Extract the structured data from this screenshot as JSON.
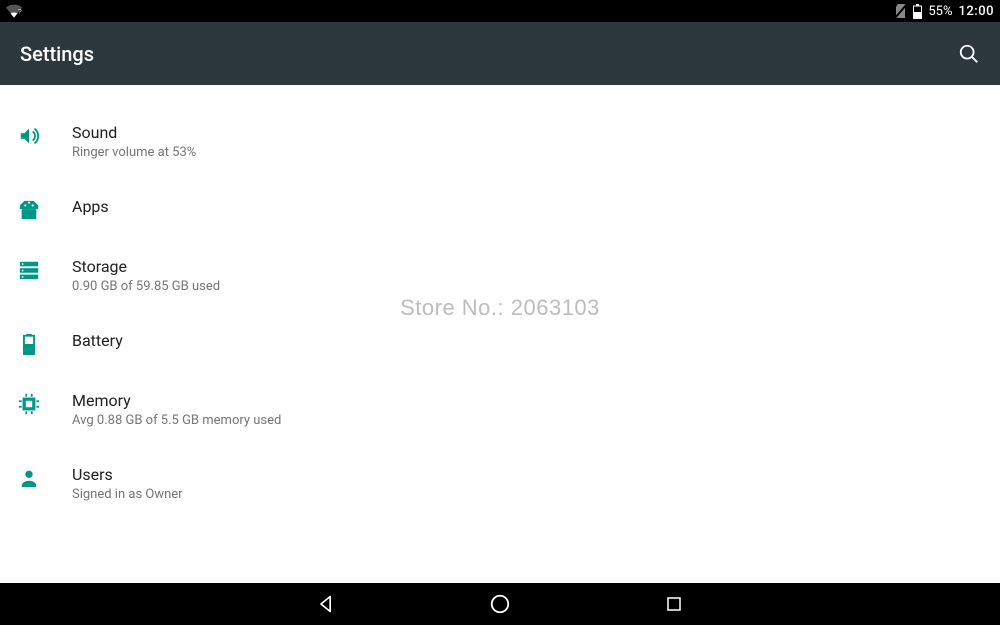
{
  "status": {
    "battery_pct": "55%",
    "clock": "12:00"
  },
  "appbar": {
    "title": "Settings"
  },
  "items": [
    {
      "icon": "sound",
      "title": "Sound",
      "sub": "Ringer volume at 53%"
    },
    {
      "icon": "apps",
      "title": "Apps",
      "sub": ""
    },
    {
      "icon": "storage",
      "title": "Storage",
      "sub": "0.90 GB of 59.85 GB used"
    },
    {
      "icon": "battery",
      "title": "Battery",
      "sub": ""
    },
    {
      "icon": "memory",
      "title": "Memory",
      "sub": "Avg 0.88 GB of 5.5 GB memory used"
    },
    {
      "icon": "users",
      "title": "Users",
      "sub": "Signed in as Owner"
    }
  ],
  "watermark": "Store No.: 2063103"
}
